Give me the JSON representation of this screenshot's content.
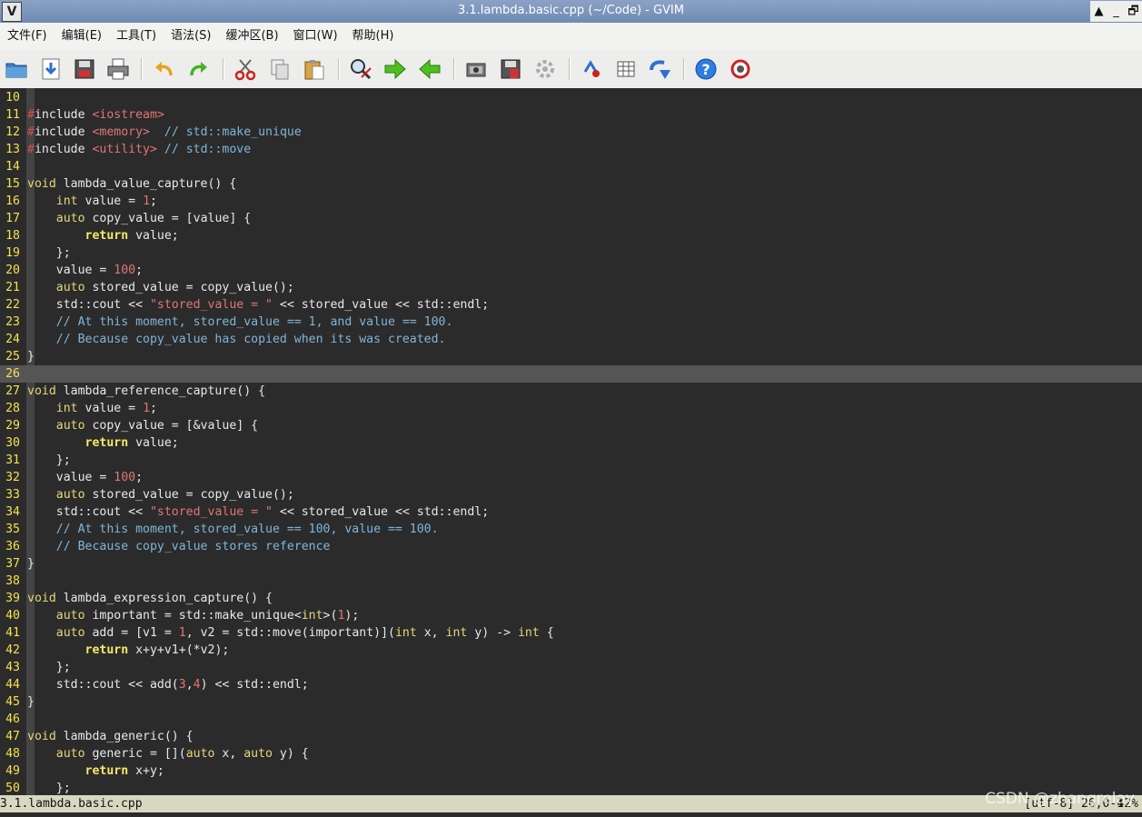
{
  "window": {
    "title": "3.1.lambda.basic.cpp (~/Code) - GVIM",
    "app_icon": "vim-logo-icon",
    "controls": [
      "▲",
      "_",
      "🗗"
    ]
  },
  "menu": [
    "文件(F)",
    "编辑(E)",
    "工具(T)",
    "语法(S)",
    "缓冲区(B)",
    "窗口(W)",
    "帮助(H)"
  ],
  "toolbar": [
    "open-folder-icon",
    "save-down-icon",
    "save-disk-icon",
    "print-icon",
    "undo-icon",
    "redo-icon",
    "cut-icon",
    "copy-icon",
    "paste-icon",
    "find-replace-icon",
    "find-next-icon",
    "find-prev-icon",
    "load-session-icon",
    "save-session-icon",
    "run-script-icon",
    "make-icon",
    "tags-table-icon",
    "jump-tag-icon",
    "help-icon",
    "find-help-icon"
  ],
  "editor": {
    "cursor_line": 26,
    "lines": [
      {
        "n": "10",
        "t": ""
      },
      {
        "n": "11",
        "t": "#include <iostream>"
      },
      {
        "n": "12",
        "t": "#include <memory>  // std::make_unique"
      },
      {
        "n": "13",
        "t": "#include <utility> // std::move"
      },
      {
        "n": "14",
        "t": ""
      },
      {
        "n": "15",
        "t": "void lambda_value_capture() {"
      },
      {
        "n": "16",
        "t": "    int value = 1;"
      },
      {
        "n": "17",
        "t": "    auto copy_value = [value] {"
      },
      {
        "n": "18",
        "t": "        return value;"
      },
      {
        "n": "19",
        "t": "    };"
      },
      {
        "n": "20",
        "t": "    value = 100;"
      },
      {
        "n": "21",
        "t": "    auto stored_value = copy_value();"
      },
      {
        "n": "22",
        "t": "    std::cout << \"stored_value = \" << stored_value << std::endl;"
      },
      {
        "n": "23",
        "t": "    // At this moment, stored_value == 1, and value == 100."
      },
      {
        "n": "24",
        "t": "    // Because copy_value has copied when its was created."
      },
      {
        "n": "25",
        "t": "}"
      },
      {
        "n": "26",
        "t": ""
      },
      {
        "n": "27",
        "t": "void lambda_reference_capture() {"
      },
      {
        "n": "28",
        "t": "    int value = 1;"
      },
      {
        "n": "29",
        "t": "    auto copy_value = [&value] {"
      },
      {
        "n": "30",
        "t": "        return value;"
      },
      {
        "n": "31",
        "t": "    };"
      },
      {
        "n": "32",
        "t": "    value = 100;"
      },
      {
        "n": "33",
        "t": "    auto stored_value = copy_value();"
      },
      {
        "n": "34",
        "t": "    std::cout << \"stored_value = \" << stored_value << std::endl;"
      },
      {
        "n": "35",
        "t": "    // At this moment, stored_value == 100, value == 100."
      },
      {
        "n": "36",
        "t": "    // Because copy_value stores reference"
      },
      {
        "n": "37",
        "t": "}"
      },
      {
        "n": "38",
        "t": ""
      },
      {
        "n": "39",
        "t": "void lambda_expression_capture() {"
      },
      {
        "n": "40",
        "t": "    auto important = std::make_unique<int>(1);"
      },
      {
        "n": "41",
        "t": "    auto add = [v1 = 1, v2 = std::move(important)](int x, int y) -> int {"
      },
      {
        "n": "42",
        "t": "        return x+y+v1+(*v2);"
      },
      {
        "n": "43",
        "t": "    };"
      },
      {
        "n": "44",
        "t": "    std::cout << add(3,4) << std::endl;"
      },
      {
        "n": "45",
        "t": "}"
      },
      {
        "n": "46",
        "t": ""
      },
      {
        "n": "47",
        "t": "void lambda_generic() {"
      },
      {
        "n": "48",
        "t": "    auto generic = [](auto x, auto y) {"
      },
      {
        "n": "49",
        "t": "        return x+y;"
      },
      {
        "n": "50",
        "t": "    };"
      }
    ]
  },
  "statusbar": {
    "filename": "3.1.lambda.basic.cpp",
    "position": "[utf-8] 26,0-1",
    "percent": "42%"
  },
  "watermark": "CSDN @zhangrelay"
}
